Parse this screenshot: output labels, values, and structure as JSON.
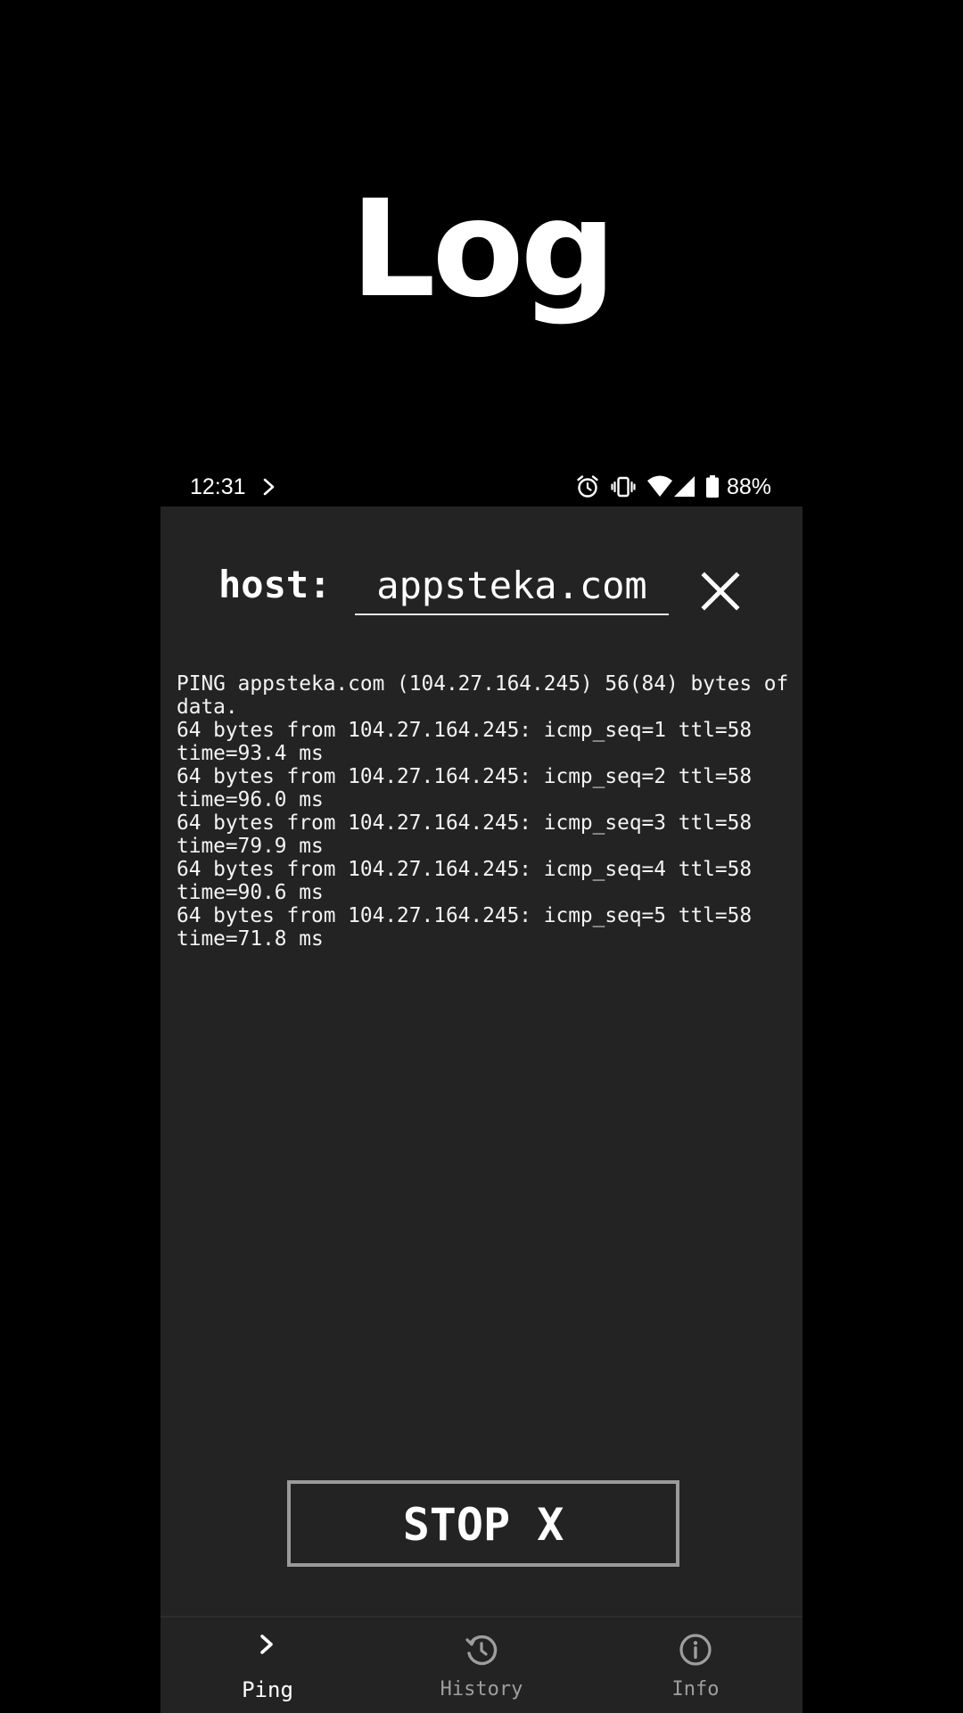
{
  "promo": {
    "title": "Log"
  },
  "status_bar": {
    "time": "12:31",
    "battery": "88%",
    "icons": [
      "chevron-right-icon",
      "alarm-icon",
      "vibrate-icon",
      "wifi-icon",
      "signal-icon",
      "battery-icon"
    ]
  },
  "host": {
    "label": "host:",
    "value": "appsteka.com"
  },
  "log": {
    "text": "PING appsteka.com (104.27.164.245) 56(84) bytes of data.\n64 bytes from 104.27.164.245: icmp_seq=1 ttl=58 time=93.4 ms\n64 bytes from 104.27.164.245: icmp_seq=2 ttl=58 time=96.0 ms\n64 bytes from 104.27.164.245: icmp_seq=3 ttl=58 time=79.9 ms\n64 bytes from 104.27.164.245: icmp_seq=4 ttl=58 time=90.6 ms\n64 bytes from 104.27.164.245: icmp_seq=5 ttl=58 time=71.8 ms"
  },
  "stop_button": {
    "label": "STOP X"
  },
  "bottom_nav": {
    "items": [
      {
        "label": "Ping",
        "icon": "chevron-right-icon",
        "active": true
      },
      {
        "label": "History",
        "icon": "history-icon",
        "active": false
      },
      {
        "label": "Info",
        "icon": "info-icon",
        "active": false
      }
    ]
  },
  "colors": {
    "background": "#000000",
    "screen": "#232323",
    "text": "#ffffff",
    "inactive": "#9e9e9e",
    "button_border": "#9a9a9a"
  }
}
